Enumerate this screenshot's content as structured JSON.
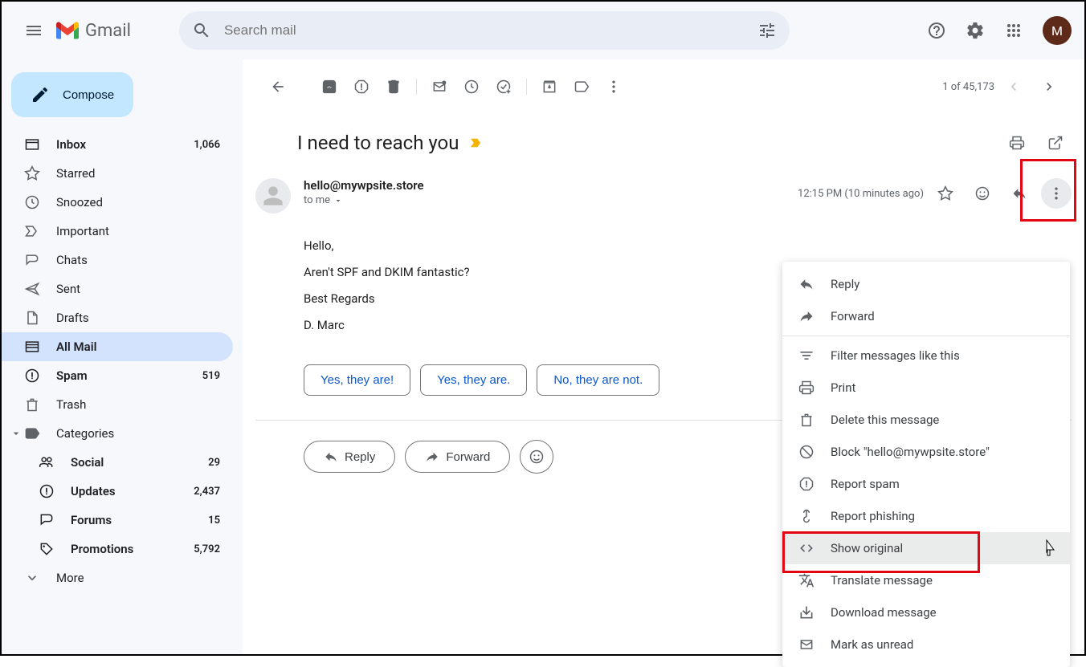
{
  "header": {
    "logo_text": "Gmail",
    "search_placeholder": "Search mail",
    "avatar_initial": "M"
  },
  "compose": "Compose",
  "sidebar": [
    {
      "label": "Inbox",
      "count": "1,066",
      "bold": true
    },
    {
      "label": "Starred",
      "count": ""
    },
    {
      "label": "Snoozed",
      "count": ""
    },
    {
      "label": "Important",
      "count": ""
    },
    {
      "label": "Chats",
      "count": ""
    },
    {
      "label": "Sent",
      "count": ""
    },
    {
      "label": "Drafts",
      "count": ""
    },
    {
      "label": "All Mail",
      "count": "",
      "active": true,
      "bold": true
    },
    {
      "label": "Spam",
      "count": "519",
      "bold": true
    },
    {
      "label": "Trash",
      "count": ""
    }
  ],
  "categories_label": "Categories",
  "categories": [
    {
      "label": "Social",
      "count": "29",
      "bold": true
    },
    {
      "label": "Updates",
      "count": "2,437",
      "bold": true
    },
    {
      "label": "Forums",
      "count": "15",
      "bold": true
    },
    {
      "label": "Promotions",
      "count": "5,792",
      "bold": true
    }
  ],
  "more_label": "More",
  "pagination": "1 of 45,173",
  "subject": "I need to reach you",
  "sender": "hello@mywpsite.store",
  "to_label": "to me",
  "timestamp": "12:15 PM (10 minutes ago)",
  "body": {
    "line1": "Hello,",
    "line2": "Aren't SPF and DKIM fantastic?",
    "line3": "Best Regards",
    "line4": "D. Marc"
  },
  "replies": [
    "Yes, they are!",
    "Yes, they are.",
    "No, they are not."
  ],
  "reply_label": "Reply",
  "forward_label": "Forward",
  "dropdown": [
    {
      "label": "Reply"
    },
    {
      "label": "Forward"
    },
    {
      "label": "Filter messages like this"
    },
    {
      "label": "Print"
    },
    {
      "label": "Delete this message"
    },
    {
      "label": "Block \"hello@mywpsite.store\""
    },
    {
      "label": "Report spam"
    },
    {
      "label": "Report phishing"
    },
    {
      "label": "Show original",
      "hover": true
    },
    {
      "label": "Translate message"
    },
    {
      "label": "Download message"
    },
    {
      "label": "Mark as unread"
    }
  ]
}
